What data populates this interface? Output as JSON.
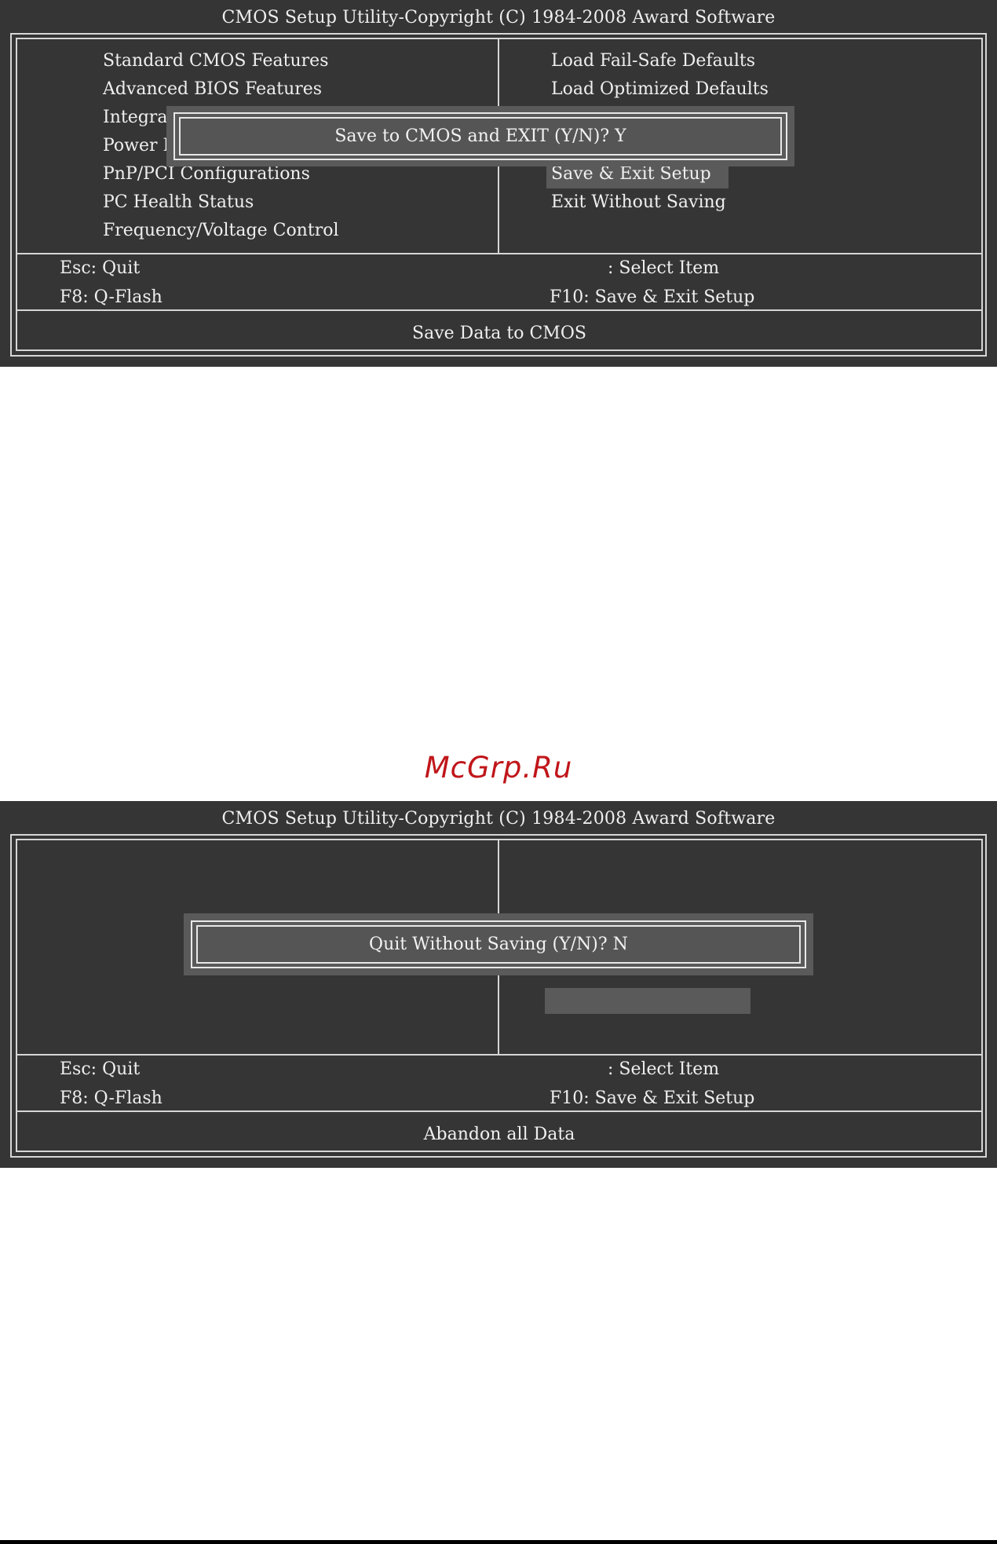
{
  "screen1": {
    "title": "CMOS Setup Utility-Copyright (C) 1984-2008 Award Software",
    "left_menu": [
      "Standard CMOS Features",
      "Advanced BIOS Features",
      "Integrat",
      "Power M",
      "PnP/PCI Configurations",
      "PC Health Status",
      "Frequency/Voltage Control"
    ],
    "right_menu": [
      "Load Fail-Safe Defaults",
      "Load Optimized Defaults",
      "",
      "",
      "Save & Exit Setup",
      "Exit Without Saving"
    ],
    "selected_item": "Save & Exit Setup",
    "dialog_text": "Save to CMOS and EXIT (Y/N)? Y",
    "keys": {
      "esc": "Esc: Quit",
      "f8": "F8: Q-Flash",
      "select": ": Select Item",
      "f10": "F10: Save & Exit Setup"
    },
    "status": "Save Data to CMOS"
  },
  "watermark": "McGrp.Ru",
  "screen2": {
    "title": "CMOS Setup Utility-Copyright (C) 1984-2008 Award Software",
    "dialog_text": "Quit Without Saving (Y/N)? N",
    "keys": {
      "esc": "Esc: Quit",
      "f8": "F8: Q-Flash",
      "select": ": Select Item",
      "f10": "F10: Save & Exit Setup"
    },
    "status": "Abandon all Data"
  }
}
